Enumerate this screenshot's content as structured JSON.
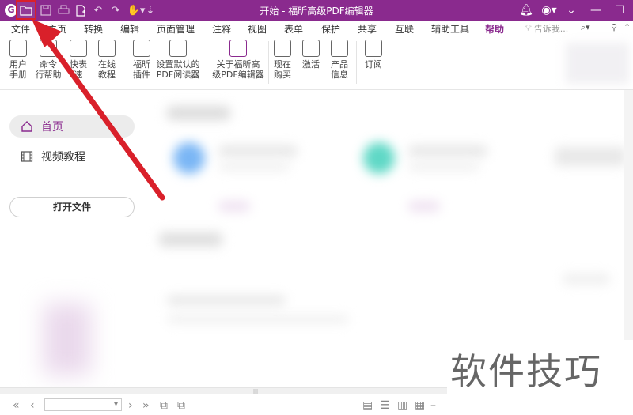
{
  "titlebar": {
    "title": "开始 - 福昕高级PDF编辑器",
    "logo_letter": "G",
    "quick_access": [
      "logo-icon",
      "open-folder-icon",
      "save-icon",
      "print-icon",
      "new-file-icon",
      "undo-icon",
      "redo-icon",
      "hand-icon",
      "customize-icon"
    ],
    "window_buttons": [
      "minimize",
      "maximize",
      "close"
    ]
  },
  "menu": {
    "tabs": [
      "文件",
      "主页",
      "转换",
      "编辑",
      "页面管理",
      "注释",
      "视图",
      "表单",
      "保护",
      "共享",
      "互联",
      "辅助工具",
      "帮助"
    ],
    "active_tab": "帮助",
    "tell_me_placeholder": "告诉我..."
  },
  "ribbon": {
    "buttons": [
      {
        "label": "用户\n手册"
      },
      {
        "label": "命令\n行帮助"
      },
      {
        "label": "快表\n速"
      },
      {
        "label": "在线\n教程"
      },
      {
        "label": "福昕\n插件"
      },
      {
        "label": "设置默认的\nPDF阅读器"
      },
      {
        "label": "关于福昕高\n级PDF编辑器"
      },
      {
        "label": "现在\n购买"
      },
      {
        "label": "激活"
      },
      {
        "label": "产品\n信息"
      },
      {
        "label": "订阅"
      }
    ]
  },
  "leftnav": {
    "home_label": "首页",
    "video_label": "视频教程",
    "open_button": "打开文件"
  },
  "watermark": "软件技巧",
  "colors": {
    "brand": "#8a2a8e",
    "arrow": "#d9202a"
  }
}
